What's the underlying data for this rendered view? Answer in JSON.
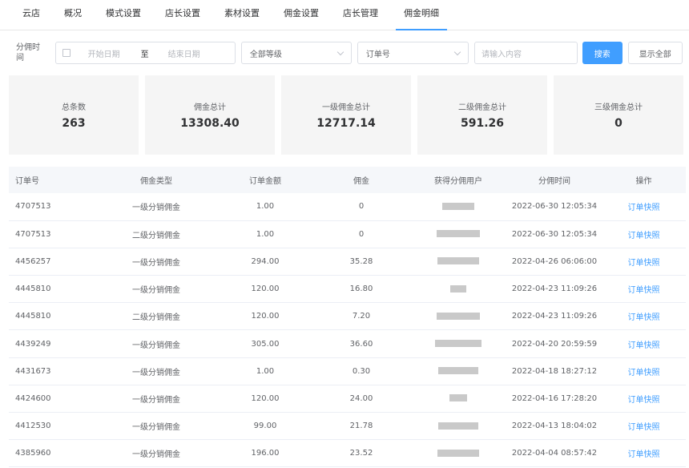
{
  "nav": {
    "tabs": [
      {
        "label": "云店",
        "active": false
      },
      {
        "label": "概况",
        "active": false
      },
      {
        "label": "模式设置",
        "active": false
      },
      {
        "label": "店长设置",
        "active": false
      },
      {
        "label": "素材设置",
        "active": false
      },
      {
        "label": "佣金设置",
        "active": false
      },
      {
        "label": "店长管理",
        "active": false
      },
      {
        "label": "佣金明细",
        "active": true
      }
    ]
  },
  "filters": {
    "label": "分佣时间",
    "start_placeholder": "开始日期",
    "range_separator": "至",
    "end_placeholder": "结束日期",
    "level_select": "全部等级",
    "field_select": "订单号",
    "input_placeholder": "请输入内容",
    "search_label": "搜索",
    "show_all_label": "显示全部"
  },
  "stats": [
    {
      "label": "总条数",
      "value": "263"
    },
    {
      "label": "佣金总计",
      "value": "13308.40"
    },
    {
      "label": "一级佣金总计",
      "value": "12717.14"
    },
    {
      "label": "二级佣金总计",
      "value": "591.26"
    },
    {
      "label": "三级佣金总计",
      "value": "0"
    }
  ],
  "table": {
    "headers": [
      "订单号",
      "佣金类型",
      "订单金额",
      "佣金",
      "获得分佣用户",
      "分佣时间",
      "操作"
    ],
    "action_label": "订单快照",
    "rows": [
      {
        "order": "4707513",
        "type": "一级分销佣金",
        "amount": "1.00",
        "commission": "0",
        "time": "2022-06-30 12:05:34"
      },
      {
        "order": "4707513",
        "type": "二级分销佣金",
        "amount": "1.00",
        "commission": "0",
        "time": "2022-06-30 12:05:34"
      },
      {
        "order": "4456257",
        "type": "一级分销佣金",
        "amount": "294.00",
        "commission": "35.28",
        "time": "2022-04-26 06:06:00"
      },
      {
        "order": "4445810",
        "type": "一级分销佣金",
        "amount": "120.00",
        "commission": "16.80",
        "time": "2022-04-23 11:09:26"
      },
      {
        "order": "4445810",
        "type": "二级分销佣金",
        "amount": "120.00",
        "commission": "7.20",
        "time": "2022-04-23 11:09:26"
      },
      {
        "order": "4439249",
        "type": "一级分销佣金",
        "amount": "305.00",
        "commission": "36.60",
        "time": "2022-04-20 20:59:59"
      },
      {
        "order": "4431673",
        "type": "一级分销佣金",
        "amount": "1.00",
        "commission": "0.30",
        "time": "2022-04-18 18:27:12"
      },
      {
        "order": "4424600",
        "type": "一级分销佣金",
        "amount": "120.00",
        "commission": "24.00",
        "time": "2022-04-16 17:28:20"
      },
      {
        "order": "4412530",
        "type": "一级分销佣金",
        "amount": "99.00",
        "commission": "21.78",
        "time": "2022-04-13 18:04:02"
      },
      {
        "order": "4385960",
        "type": "一级分销佣金",
        "amount": "196.00",
        "commission": "23.52",
        "time": "2022-04-04 08:57:42"
      }
    ]
  }
}
